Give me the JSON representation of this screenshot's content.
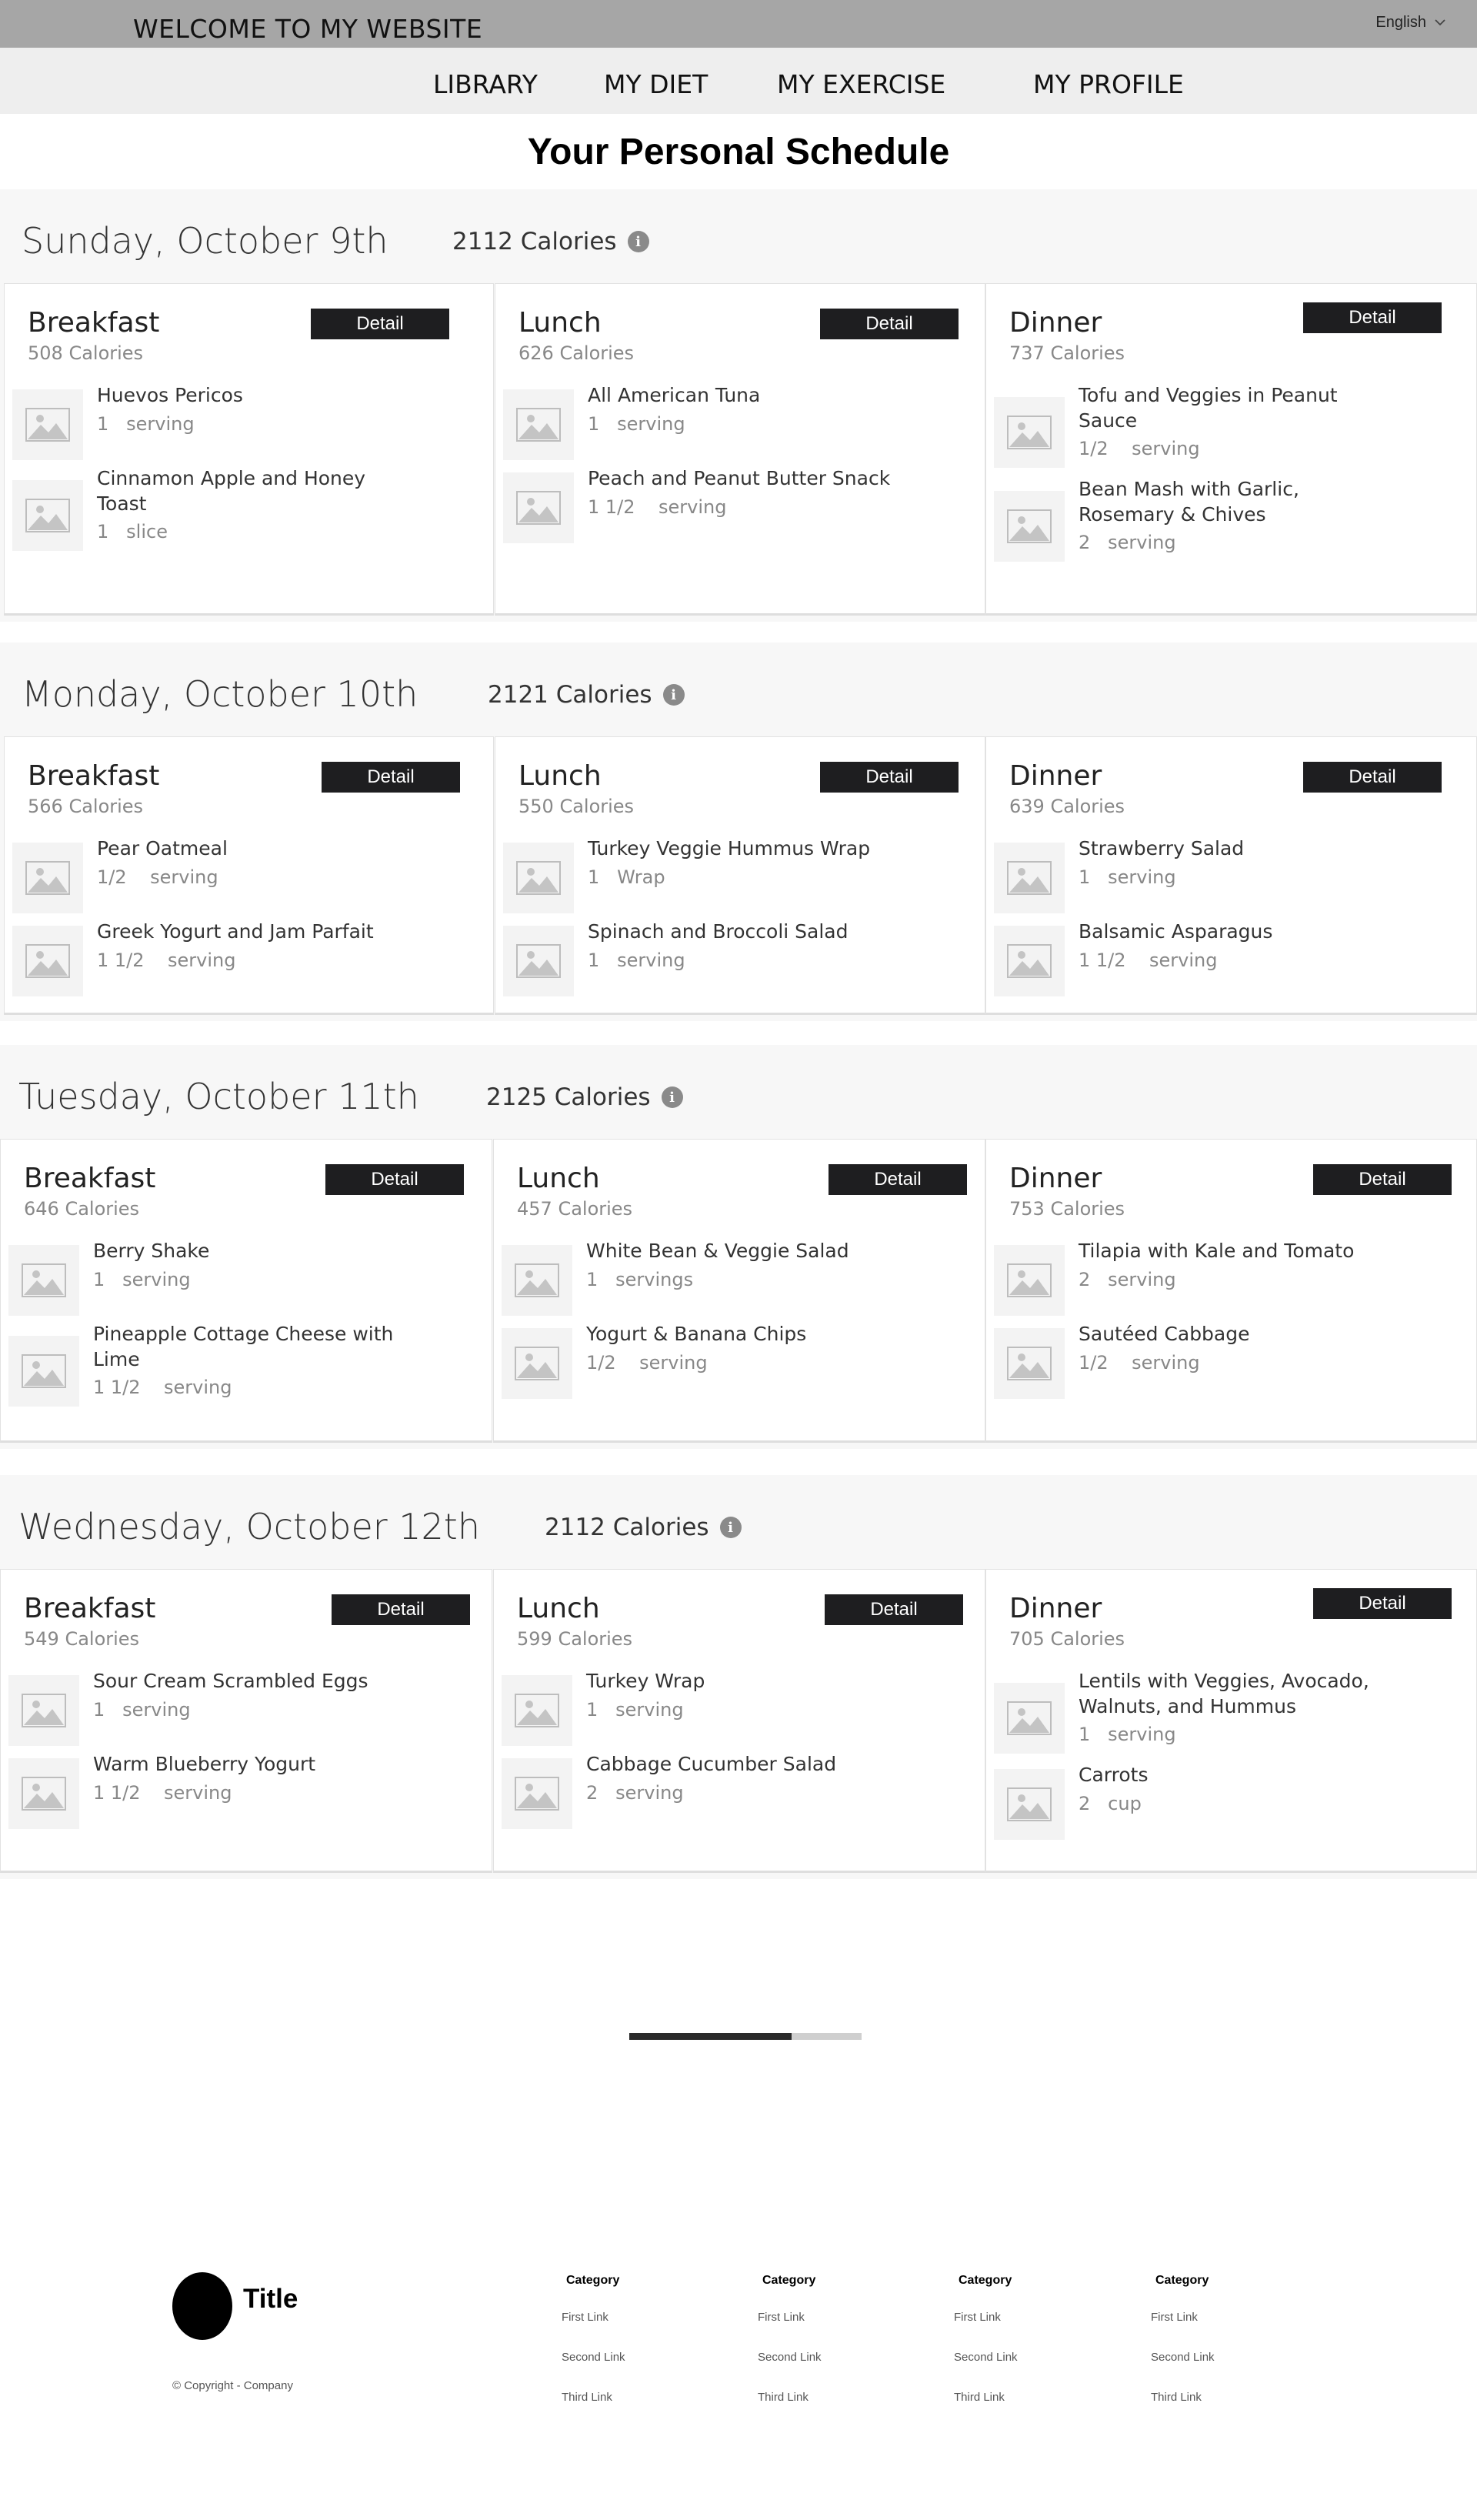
{
  "header": {
    "site_title": "WELCOME TO MY WEBSITE",
    "language": "English"
  },
  "nav": [
    "LIBRARY",
    "MY DIET",
    "MY EXERCISE",
    "MY PROFILE"
  ],
  "page_title": "Your Personal Schedule",
  "detail_label": "Detail",
  "days": [
    {
      "date": "Sunday, October 9th",
      "calories": "2112 Calories",
      "meals": [
        {
          "name": "Breakfast",
          "calories": "508 Calories",
          "foods": [
            {
              "name": "Huevos Pericos",
              "qty": "1   serving"
            },
            {
              "name": "Cinnamon Apple and Honey Toast",
              "qty": "1   slice"
            }
          ]
        },
        {
          "name": "Lunch",
          "calories": "626 Calories",
          "foods": [
            {
              "name": "All American Tuna",
              "qty": "1   serving"
            },
            {
              "name": "Peach and Peanut Butter Snack",
              "qty": "1 1/2    serving"
            }
          ]
        },
        {
          "name": "Dinner",
          "calories": "737 Calories",
          "foods": [
            {
              "name": "Tofu and Veggies in Peanut Sauce",
              "qty": "1/2    serving"
            },
            {
              "name": "Bean Mash with Garlic, Rosemary & Chives",
              "qty": "2   serving"
            }
          ]
        }
      ]
    },
    {
      "date": "Monday, October 10th",
      "calories": "2121 Calories",
      "meals": [
        {
          "name": "Breakfast",
          "calories": "566 Calories",
          "foods": [
            {
              "name": "Pear Oatmeal",
              "qty": "1/2    serving"
            },
            {
              "name": "Greek Yogurt and Jam Parfait",
              "qty": "1 1/2    serving"
            }
          ]
        },
        {
          "name": "Lunch",
          "calories": "550 Calories",
          "foods": [
            {
              "name": "Turkey Veggie Hummus Wrap",
              "qty": "1   Wrap"
            },
            {
              "name": "Spinach and Broccoli Salad",
              "qty": "1   serving"
            }
          ]
        },
        {
          "name": "Dinner",
          "calories": "639 Calories",
          "foods": [
            {
              "name": "Strawberry Salad",
              "qty": "1   serving"
            },
            {
              "name": "Balsamic Asparagus",
              "qty": "1 1/2    serving"
            }
          ]
        }
      ]
    },
    {
      "date": "Tuesday, October 11th",
      "calories": "2125 Calories",
      "meals": [
        {
          "name": "Breakfast",
          "calories": "646 Calories",
          "foods": [
            {
              "name": "Berry Shake",
              "qty": "1   serving"
            },
            {
              "name": "Pineapple Cottage Cheese with Lime",
              "qty": "1 1/2    serving"
            }
          ]
        },
        {
          "name": "Lunch",
          "calories": "457 Calories",
          "foods": [
            {
              "name": "White Bean & Veggie Salad",
              "qty": "1   servings"
            },
            {
              "name": "Yogurt & Banana Chips",
              "qty": "1/2    serving"
            }
          ]
        },
        {
          "name": "Dinner",
          "calories": "753 Calories",
          "foods": [
            {
              "name": "Tilapia with Kale and Tomato",
              "qty": "2   serving"
            },
            {
              "name": "Sautéed Cabbage",
              "qty": "1/2    serving"
            }
          ]
        }
      ]
    },
    {
      "date": "Wednesday, October 12th",
      "calories": "2112 Calories",
      "meals": [
        {
          "name": "Breakfast",
          "calories": "549 Calories",
          "foods": [
            {
              "name": "Sour Cream Scrambled Eggs",
              "qty": "1   serving"
            },
            {
              "name": "Warm Blueberry Yogurt",
              "qty": "1 1/2    serving"
            }
          ]
        },
        {
          "name": "Lunch",
          "calories": "599 Calories",
          "foods": [
            {
              "name": "Turkey Wrap",
              "qty": "1   serving"
            },
            {
              "name": "Cabbage Cucumber Salad",
              "qty": "2   serving"
            }
          ]
        },
        {
          "name": "Dinner",
          "calories": "705 Calories",
          "foods": [
            {
              "name": "Lentils with Veggies, Avocado, Walnuts, and Hummus",
              "qty": "1   serving"
            },
            {
              "name": "Carrots",
              "qty": "2   cup"
            }
          ]
        }
      ]
    }
  ],
  "pager": {
    "progress": 0.7
  },
  "footer": {
    "title": "Title",
    "copyright": "© Copyright - Company",
    "columns": [
      {
        "category": "Category",
        "links": [
          "First Link",
          "Second Link",
          "Third Link"
        ]
      },
      {
        "category": "Category",
        "links": [
          "First Link",
          "Second Link",
          "Third Link"
        ]
      },
      {
        "category": "Category",
        "links": [
          "First Link",
          "Second Link",
          "Third Link"
        ]
      },
      {
        "category": "Category",
        "links": [
          "First Link",
          "Second Link",
          "Third Link"
        ]
      }
    ]
  }
}
